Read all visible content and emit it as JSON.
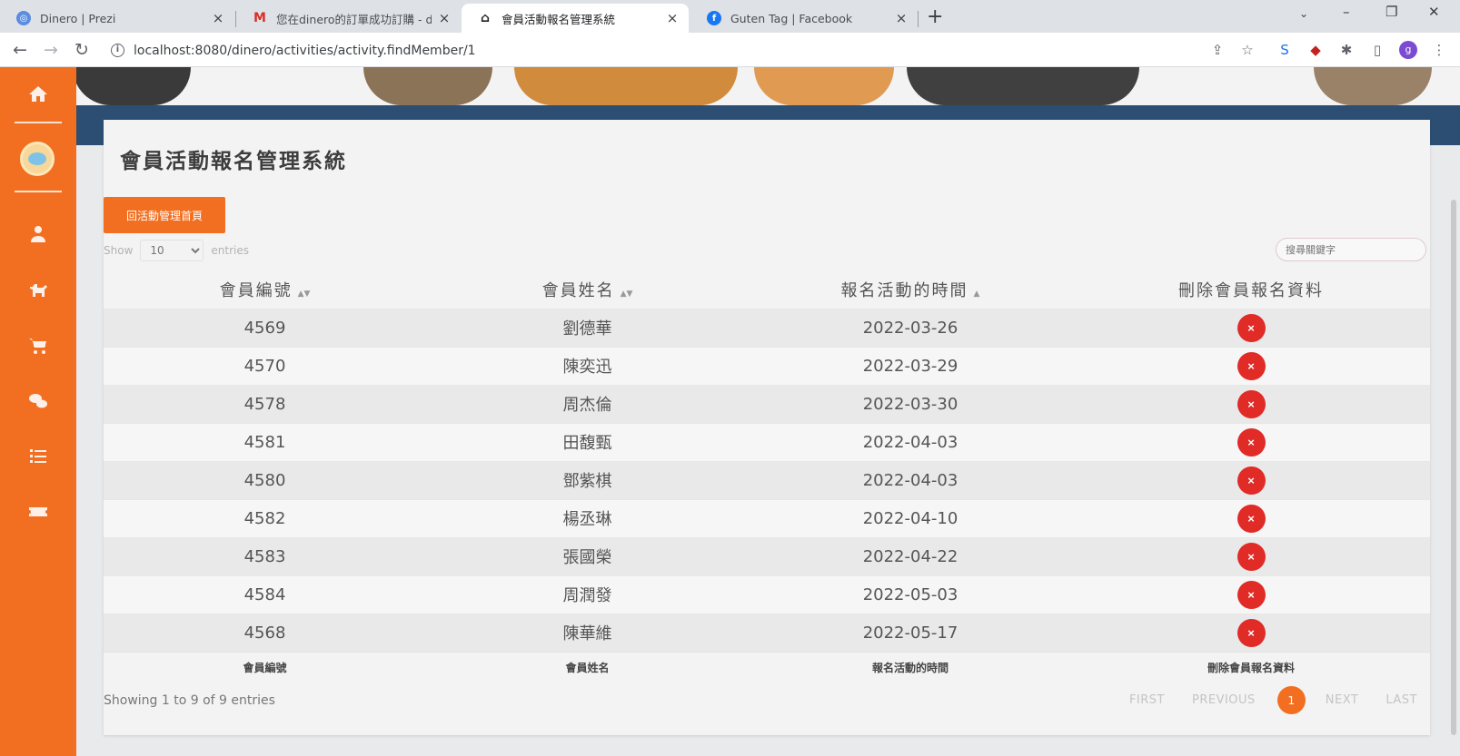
{
  "browser": {
    "tabs": [
      {
        "title": "Dinero | Prezi",
        "icon": "prezi-icon",
        "color": "#5a8de0"
      },
      {
        "title": "您在dinero的訂單成功訂購 - dc",
        "icon": "gmail-icon",
        "color": "#d93025"
      },
      {
        "title": "會員活動報名管理系統",
        "icon": "mask-icon",
        "color": "#202124"
      },
      {
        "title": "Guten Tag | Facebook",
        "icon": "facebook-icon",
        "color": "#1877f2"
      }
    ],
    "url": "localhost:8080/dinero/activities/activity.findMember/1"
  },
  "colors": {
    "accent": "#f26f21",
    "delete": "#e02b27",
    "header_band": "#2d4e73"
  },
  "page": {
    "title": "會員活動報名管理系統",
    "back_label": "回活動管理首頁",
    "show_label": "Show",
    "entries_label": "entries",
    "page_length": "10",
    "search_placeholder": "搜尋關鍵字"
  },
  "table": {
    "columns": [
      "會員編號",
      "會員姓名",
      "報名活動的時間",
      "刪除會員報名資料"
    ],
    "rows": [
      [
        "4569",
        "劉德華",
        "2022-03-26"
      ],
      [
        "4570",
        "陳奕迅",
        "2022-03-29"
      ],
      [
        "4578",
        "周杰倫",
        "2022-03-30"
      ],
      [
        "4581",
        "田馥甄",
        "2022-04-03"
      ],
      [
        "4580",
        "鄧紫棋",
        "2022-04-03"
      ],
      [
        "4582",
        "楊丞琳",
        "2022-04-10"
      ],
      [
        "4583",
        "張國榮",
        "2022-04-22"
      ],
      [
        "4584",
        "周潤發",
        "2022-05-03"
      ],
      [
        "4568",
        "陳華維",
        "2022-05-17"
      ]
    ],
    "delete_glyph": "×"
  },
  "footer": {
    "info": "Showing 1 to 9 of 9 entries",
    "first": "FIRST",
    "previous": "PREVIOUS",
    "current": "1",
    "next": "NEXT",
    "last": "LAST"
  }
}
